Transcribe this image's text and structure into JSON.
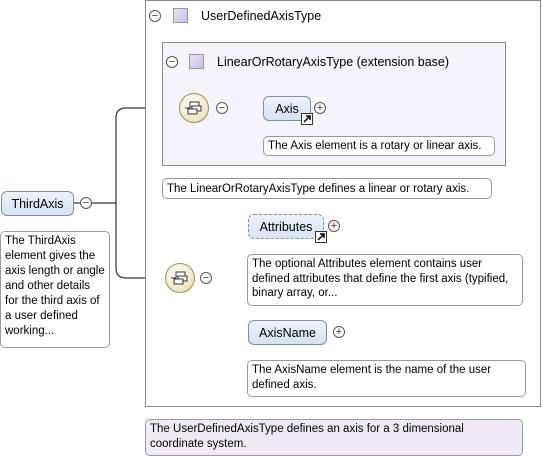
{
  "root_element": {
    "label": "ThirdAxis",
    "doc": "The ThirdAxis element gives the axis length or angle and other details for the third axis of a user defined working..."
  },
  "type": {
    "title": "UserDefinedAxisType",
    "doc": "The UserDefinedAxisType defines an axis for a 3 dimensional coordinate system."
  },
  "extension": {
    "title": "LinearOrRotaryAxisType (extension base)",
    "doc": "The LinearOrRotaryAxisType defines a linear or rotary axis.",
    "elements": [
      {
        "label": "Axis",
        "doc": "The Axis element is a rotary or linear axis.",
        "reference": true,
        "expandable": true
      }
    ]
  },
  "sequence_elements": [
    {
      "label": "Attributes",
      "doc": "The optional Attributes element contains user defined attributes that define the first axis (typified, binary array, or...",
      "optional": true,
      "reference": true,
      "expandable": true
    },
    {
      "label": "AxisName",
      "doc": "The AxisName element is the name of the user defined axis.",
      "optional": false,
      "reference": false,
      "expandable": true
    }
  ],
  "icons": {
    "collapse": "minus-circle-icon",
    "expand": "plus-circle-icon",
    "sequence": "sequence-compositor-icon",
    "reference": "reference-arrow-icon",
    "type": "complex-type-icon"
  },
  "colors": {
    "element_fill": "#d6e3f4",
    "type_fill": "#f5f3fb",
    "doc_fill_type": "#efeaf6",
    "sequence_fill": "#f3eccb"
  }
}
